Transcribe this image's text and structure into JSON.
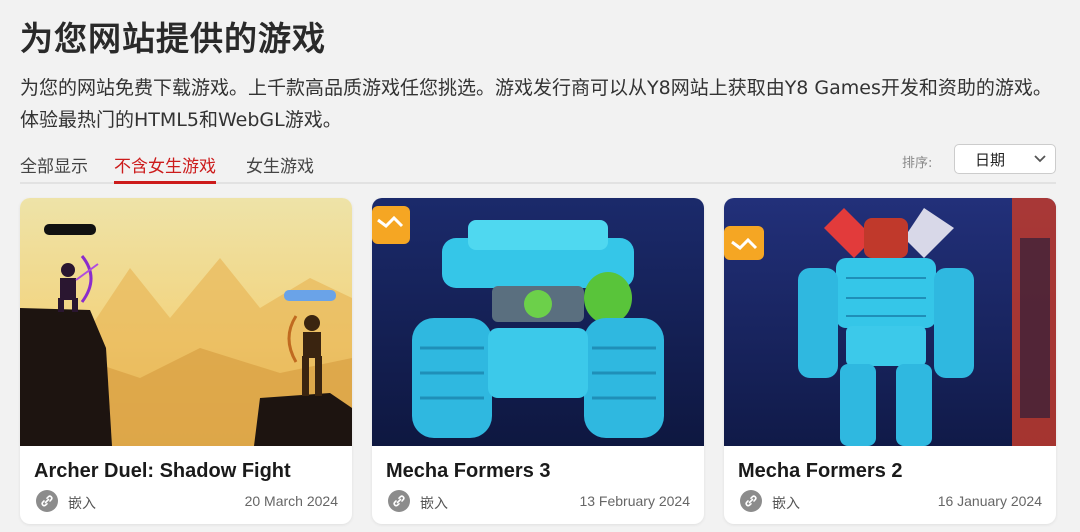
{
  "header": {
    "title": "为您网站提供的游戏",
    "description": "为您的网站免费下载游戏。上千款高品质游戏任您挑选。游戏发行商可以从Y8网站上获取由Y8 Games开发和资助的游戏。体验最热门的HTML5和WebGL游戏。"
  },
  "tabs": [
    {
      "label": "全部显示",
      "active": false
    },
    {
      "label": "不含女生游戏",
      "active": true
    },
    {
      "label": "女生游戏",
      "active": false
    }
  ],
  "sort": {
    "label": "排序:",
    "selected": "日期"
  },
  "games": [
    {
      "title": "Archer Duel: Shadow Fight",
      "embed_label": "嵌入",
      "date": "20 March 2024"
    },
    {
      "title": "Mecha Formers 3",
      "embed_label": "嵌入",
      "date": "13 February 2024"
    },
    {
      "title": "Mecha Formers 2",
      "embed_label": "嵌入",
      "date": "16 January 2024"
    }
  ],
  "colors": {
    "accent": "#cc1b1b",
    "background": "#f2f2f2",
    "card": "#ffffff"
  }
}
